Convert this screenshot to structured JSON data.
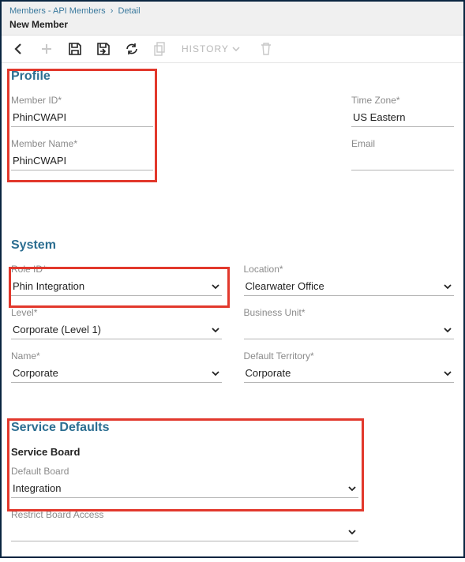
{
  "breadcrumb": {
    "parent": "Members - API Members",
    "current": "Detail"
  },
  "page_title": "New Member",
  "toolbar": {
    "history_label": "HISTORY"
  },
  "profile": {
    "title": "Profile",
    "member_id_label": "Member ID*",
    "member_id_value": "PhinCWAPI",
    "member_name_label": "Member Name*",
    "member_name_value": "PhinCWAPI",
    "time_zone_label": "Time Zone*",
    "time_zone_value": "US Eastern",
    "email_label": "Email",
    "email_value": ""
  },
  "system": {
    "title": "System",
    "role_id_label": "Role ID*",
    "role_id_value": "Phin Integration",
    "level_label": "Level*",
    "level_value": "Corporate (Level 1)",
    "name_label": "Name*",
    "name_value": "Corporate",
    "location_label": "Location*",
    "location_value": "Clearwater Office",
    "business_unit_label": "Business Unit*",
    "business_unit_value": "",
    "default_territory_label": "Default Territory*",
    "default_territory_value": "Corporate"
  },
  "service_defaults": {
    "title": "Service Defaults",
    "service_board_title": "Service Board",
    "default_board_label": "Default Board",
    "default_board_value": "Integration",
    "restrict_board_label": "Restrict Board Access",
    "restrict_board_value": ""
  }
}
